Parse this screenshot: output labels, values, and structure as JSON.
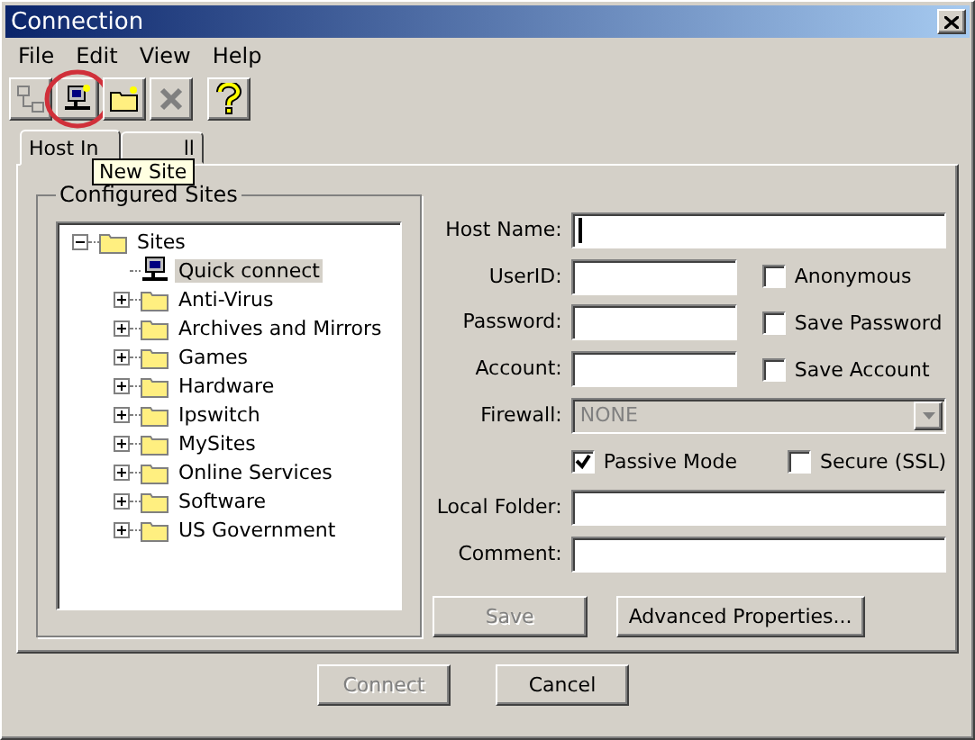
{
  "window": {
    "title": "Connection"
  },
  "menu": [
    "File",
    "Edit",
    "View",
    "Help"
  ],
  "toolbar": [
    {
      "kind": "connect",
      "disabled": true,
      "highlighted": false
    },
    {
      "kind": "new-site",
      "disabled": false,
      "highlighted": true
    },
    {
      "kind": "new-folder",
      "disabled": false,
      "highlighted": false
    },
    {
      "kind": "delete",
      "disabled": true,
      "highlighted": false
    },
    {
      "kind": "help",
      "disabled": false,
      "highlighted": false
    }
  ],
  "tooltip": {
    "text": "New Site"
  },
  "tabs": [
    {
      "label": "Host In",
      "selected": true
    },
    {
      "label": "ll",
      "selected": false
    }
  ],
  "sites": {
    "title": "Configured Sites",
    "tree": [
      {
        "label": "Sites",
        "kind": "folder",
        "expanded": true,
        "selected": false,
        "children": [
          {
            "label": "Quick connect",
            "kind": "computer",
            "selected": true
          },
          {
            "label": "Anti-Virus",
            "kind": "folder",
            "expanded": false,
            "selected": false
          },
          {
            "label": "Archives and Mirrors",
            "kind": "folder",
            "expanded": false,
            "selected": false
          },
          {
            "label": "Games",
            "kind": "folder",
            "expanded": false,
            "selected": false
          },
          {
            "label": "Hardware",
            "kind": "folder",
            "expanded": false,
            "selected": false
          },
          {
            "label": "Ipswitch",
            "kind": "folder",
            "expanded": false,
            "selected": false
          },
          {
            "label": "MySites",
            "kind": "folder",
            "expanded": false,
            "selected": false
          },
          {
            "label": "Online Services",
            "kind": "folder",
            "expanded": false,
            "selected": false
          },
          {
            "label": "Software",
            "kind": "folder",
            "expanded": false,
            "selected": false
          },
          {
            "label": "US Government",
            "kind": "folder",
            "expanded": false,
            "selected": false
          }
        ]
      }
    ]
  },
  "form": [
    {
      "kind": "text",
      "label": "Host Name:",
      "focused": true
    },
    {
      "kind": "text-check",
      "label": "UserID:",
      "focused": false,
      "check": {
        "label": "Anonymous",
        "checked": false
      }
    },
    {
      "kind": "text-check",
      "label": "Password:",
      "focused": false,
      "check": {
        "label": "Save Password",
        "checked": false
      }
    },
    {
      "kind": "text-check",
      "label": "Account:",
      "focused": false,
      "check": {
        "label": "Save Account",
        "checked": false
      }
    },
    {
      "kind": "select",
      "label": "Firewall:",
      "value": "NONE",
      "disabled": true
    },
    {
      "kind": "checks",
      "checks": [
        {
          "label": "Passive Mode",
          "checked": true
        },
        {
          "label": "Secure (SSL)",
          "checked": false
        }
      ]
    },
    {
      "kind": "text",
      "label": "Local Folder:",
      "focused": false
    },
    {
      "kind": "text",
      "label": "Comment:",
      "focused": false
    }
  ],
  "form_buttons": [
    {
      "label": "Save",
      "disabled": true
    },
    {
      "label": "Advanced Properties...",
      "disabled": false
    }
  ],
  "dialog_buttons": [
    {
      "label": "Connect",
      "disabled": true
    },
    {
      "label": "Cancel",
      "disabled": false
    }
  ]
}
